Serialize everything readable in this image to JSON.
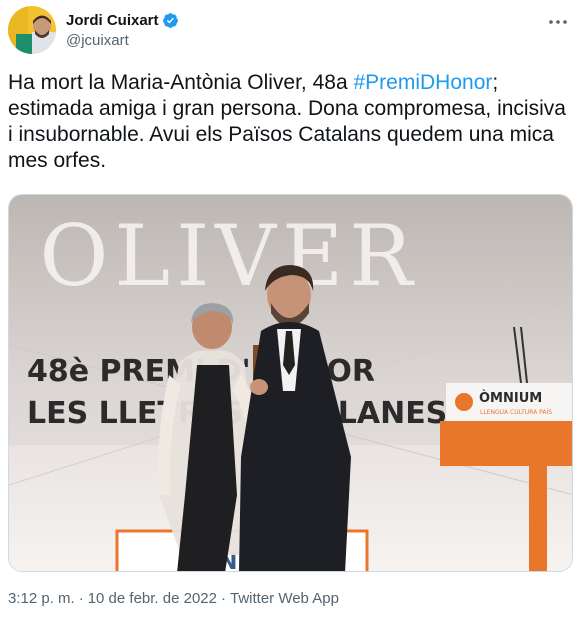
{
  "user": {
    "display_name": "Jordi Cuixart",
    "handle": "@jcuixart"
  },
  "tweet": {
    "text_before": "Ha mort la Maria-Antònia Oliver, 48a ",
    "hashtag": "#PremiDHonor",
    "text_after": "; estimada amiga i gran persona. Dona compromesa, incisiva i insubornable. Avui els Països Catalans quedem una mica mes orfes."
  },
  "media": {
    "banner_word": "OLIVER",
    "banner_line1": "48è PREMI D'HONOR",
    "banner_line2": "LES LLETRES CATALANES",
    "podium_name": "ÒMNIUM",
    "podium_tagline": "LLENGUA CULTURA PAÍS",
    "podium_front": "NIU"
  },
  "meta": {
    "time": "3:12 p. m.",
    "separator": "·",
    "date": "10 de febr. de 2022",
    "source": "Twitter Web App"
  },
  "colors": {
    "text": "#0f1419",
    "secondary": "#536471",
    "link": "#1d9bf0",
    "podium": "#e8772c"
  },
  "icons": {
    "verified": "verified-badge-icon",
    "more": "more-horizontal-icon"
  }
}
